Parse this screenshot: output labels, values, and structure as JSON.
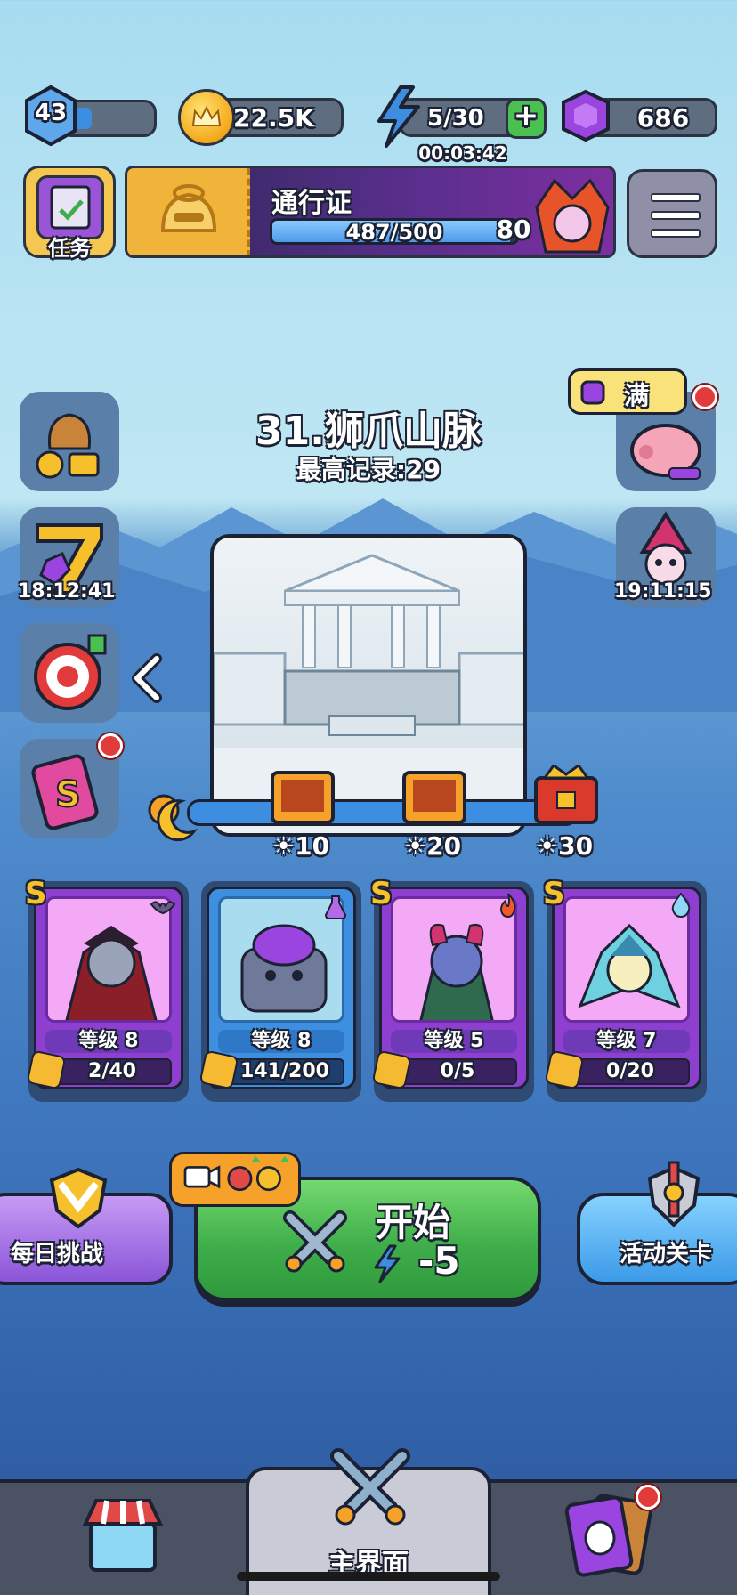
{
  "top_bar": {
    "player_level": "43",
    "coins": "22.5K",
    "energy": "5/30",
    "energy_timer": "00:03:42",
    "gems": "686",
    "energy_plus": "+"
  },
  "quest_button": {
    "label": "任务"
  },
  "battle_pass": {
    "title": "通行证",
    "progress_text": "487/500",
    "progress_value": 0.974,
    "level": "80"
  },
  "stage": {
    "title": "31.狮爪山脉",
    "record": "最高记录:29",
    "milestones": [
      "10",
      "20",
      "30"
    ]
  },
  "left_buttons": {
    "event_timer": "18:12:41",
    "event_number": "7"
  },
  "right_buttons": {
    "piggy_bank_label": "满",
    "hero_event_timer": "19:11:15"
  },
  "heroes": [
    {
      "rank": "S",
      "level": "等级 8",
      "shards": "2/40",
      "element": "bat-icon"
    },
    {
      "rank": "",
      "level": "等级 8",
      "shards": "141/200",
      "element": "potion-icon"
    },
    {
      "rank": "S",
      "level": "等级 5",
      "shards": "0/5",
      "element": "fire-icon"
    },
    {
      "rank": "S",
      "level": "等级 7",
      "shards": "0/20",
      "element": "water-icon"
    }
  ],
  "actions": {
    "daily_challenge": "每日挑战",
    "start_label": "开始",
    "start_cost": "-5",
    "event_stage": "活动关卡"
  },
  "bottom_nav": {
    "main_label": "主界面"
  },
  "colors": {
    "accent_green": "#3fae4a",
    "accent_purple": "#8f3fd0",
    "accent_blue": "#3f8fe0",
    "gold": "#f5b932"
  }
}
